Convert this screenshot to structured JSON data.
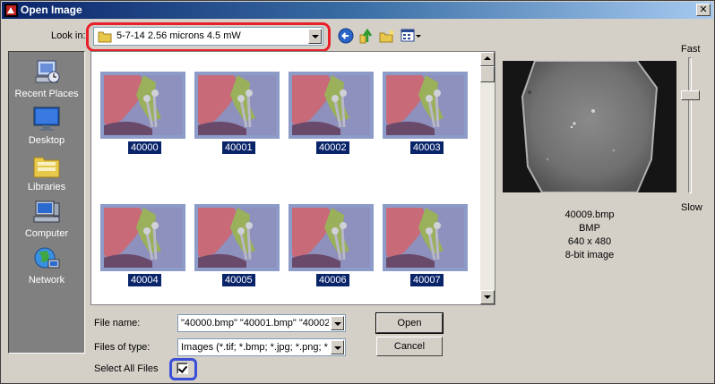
{
  "window": {
    "title": "Open Image",
    "close_glyph": "✕"
  },
  "lookin": {
    "label": "Look in:",
    "value": "5-7-14 2.56 microns 4.5 mW",
    "folder_icon": "folder-icon"
  },
  "toolbar": {
    "back_icon": "back-arrow-icon",
    "up_icon": "up-folder-icon",
    "new_icon": "new-folder-icon",
    "view_icon": "view-menu-icon"
  },
  "places": [
    {
      "label": "Recent Places",
      "icon": "recent-places-icon"
    },
    {
      "label": "Desktop",
      "icon": "desktop-icon"
    },
    {
      "label": "Libraries",
      "icon": "libraries-icon"
    },
    {
      "label": "Computer",
      "icon": "computer-icon"
    },
    {
      "label": "Network",
      "icon": "network-icon"
    }
  ],
  "files": [
    {
      "name": "40000"
    },
    {
      "name": "40001"
    },
    {
      "name": "40002"
    },
    {
      "name": "40003"
    },
    {
      "name": "40004"
    },
    {
      "name": "40005"
    },
    {
      "name": "40006"
    },
    {
      "name": "40007"
    }
  ],
  "preview": {
    "speed_fast": "Fast",
    "speed_slow": "Slow",
    "filename": "40009.bmp",
    "format": "BMP",
    "dimensions": "640 x 480",
    "depth": "8-bit image"
  },
  "filename": {
    "label": "File name:",
    "value": "\"40000.bmp\" \"40001.bmp\" \"40002"
  },
  "filetype": {
    "label": "Files of type:",
    "value": "Images (*.tif; *.bmp; *.jpg; *.png; *.a"
  },
  "buttons": {
    "open": "Open",
    "cancel": "Cancel"
  },
  "select_all": {
    "label": "Select All Files",
    "checked": true
  },
  "colors": {
    "highlight_red": "#e8202a",
    "highlight_blue": "#3a4ed8",
    "selection": "#0a246a"
  }
}
